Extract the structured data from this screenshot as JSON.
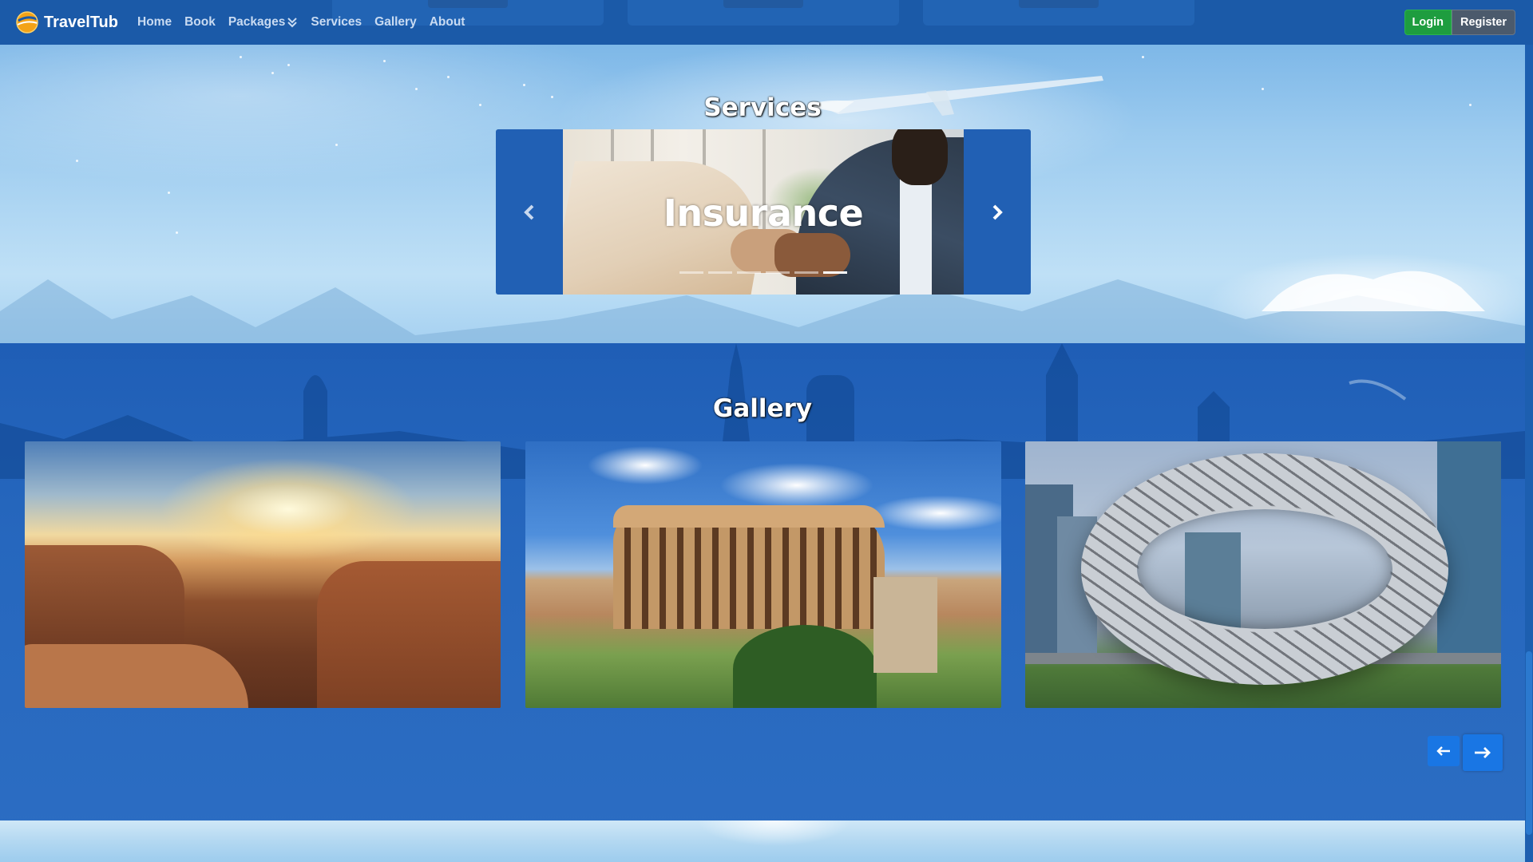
{
  "navbar": {
    "brand": "TravelTub",
    "links": [
      {
        "label": "Home"
      },
      {
        "label": "Book"
      },
      {
        "label": "Packages",
        "has_dropdown": true
      },
      {
        "label": "Services"
      },
      {
        "label": "Gallery"
      },
      {
        "label": "About"
      }
    ],
    "login_label": "Login",
    "register_label": "Register"
  },
  "services": {
    "title": "Services",
    "carousel": {
      "active_caption": "Insurance",
      "indicator_count": 6,
      "active_indicator": 5
    }
  },
  "gallery": {
    "title": "Gallery",
    "images": [
      {
        "subject": "Grand Canyon sunset"
      },
      {
        "subject": "Colosseum, Rome"
      },
      {
        "subject": "Museum of the Future, Dubai"
      }
    ]
  },
  "colors": {
    "navbar_bg": "#1b5aa8",
    "login_green": "#1e9d3f",
    "register_gray": "#4b5a6c",
    "gallery_bg": "#1e60ba",
    "accent_blue": "#1976e4"
  },
  "icons": {
    "brand": "globe-logo-icon",
    "packages_dropdown": "double-chevron-down-icon",
    "carousel_prev": "chevron-left-icon",
    "carousel_next": "chevron-right-icon",
    "gallery_prev": "arrow-left-icon",
    "gallery_next": "arrow-right-icon"
  }
}
